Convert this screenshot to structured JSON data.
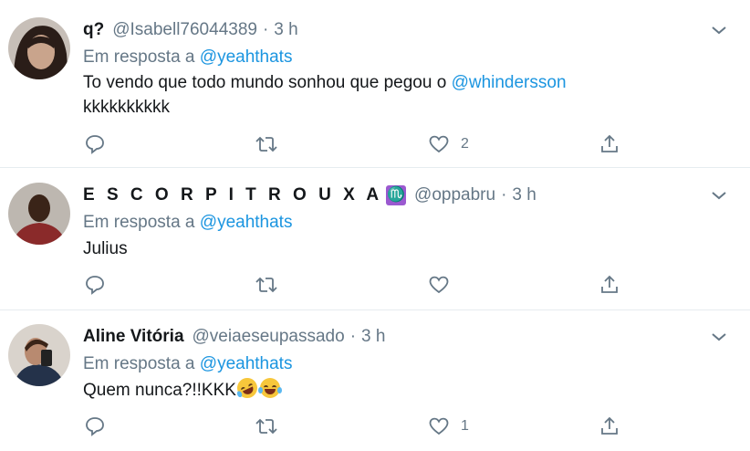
{
  "tweets": [
    {
      "display_name": "q?",
      "handle": "@Isabell76044389",
      "time": "3 h",
      "reply_prefix": "Em resposta a",
      "reply_to": "@yeahthats",
      "text_line1": "To vendo que todo mundo sonhou que pegou o",
      "text_mention": "@whindersson",
      "text_line2": "kkkkkkkkkk",
      "like_count": "2",
      "avatar_bg": "#3a2c28"
    },
    {
      "display_name": "E S C O R P I T R O U X A",
      "badge": "♏",
      "handle": "@oppabru",
      "time": "3 h",
      "reply_prefix": "Em resposta a",
      "reply_to": "@yeahthats",
      "text_line1": "Julius",
      "like_count": "",
      "avatar_bg": "#b9b3ac"
    },
    {
      "display_name": "Aline Vitória",
      "handle": "@veiaeseupassado",
      "time": "3 h",
      "reply_prefix": "Em resposta a",
      "reply_to": "@yeahthats",
      "text_line1": "Quem nunca?!!KKK",
      "emoji_1": "rolling-on-floor-laughing-emoji",
      "emoji_2": "face-with-tears-of-joy-emoji",
      "like_count": "1",
      "avatar_bg": "#d9d2cc"
    }
  ],
  "colors": {
    "link": "#1b95e0",
    "secondary": "#657786",
    "divider": "#e6ecf0"
  }
}
